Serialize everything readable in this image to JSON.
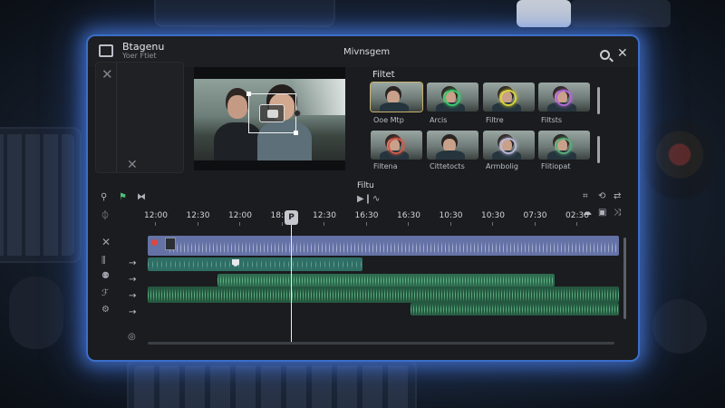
{
  "app": {
    "name": "Btagenu",
    "subtitle": "Yoer Ftiet"
  },
  "window": {
    "title": "Mivnsgem"
  },
  "filters": {
    "title": "Filtet",
    "items": [
      {
        "label": "Ooe Mtp",
        "ring": "",
        "selected": true
      },
      {
        "label": "Arcis",
        "ring": "#38c96a"
      },
      {
        "label": "Filtre",
        "ring": "#d8d33a"
      },
      {
        "label": "Filtsts",
        "ring": "#b06ad4"
      },
      {
        "label": "Filtena",
        "ring": "#d05a4a"
      },
      {
        "label": "Cittetocts",
        "ring": ""
      },
      {
        "label": "Armbolig",
        "ring": "#b7b7d8"
      },
      {
        "label": "Flitiopat",
        "ring": "#5aaa7a"
      }
    ]
  },
  "panel_label": "Filtu",
  "timeline": {
    "ruler": [
      "12:00",
      "12:30",
      "12:00",
      "18:30",
      "12:30",
      "16:30",
      "16:30",
      "10:30",
      "10:30",
      "07:30",
      "02:30"
    ],
    "playhead_label": "P"
  },
  "icons": {
    "app": "app-window-icon",
    "search": "search-icon",
    "close": "close-icon"
  },
  "colors": {
    "accent_glow": "#3a6ec9",
    "video_track": "#6472a6",
    "video_track_2": "#2f6e64",
    "audio_track": "#2d6b4f",
    "record_dot": "#e2453e"
  }
}
